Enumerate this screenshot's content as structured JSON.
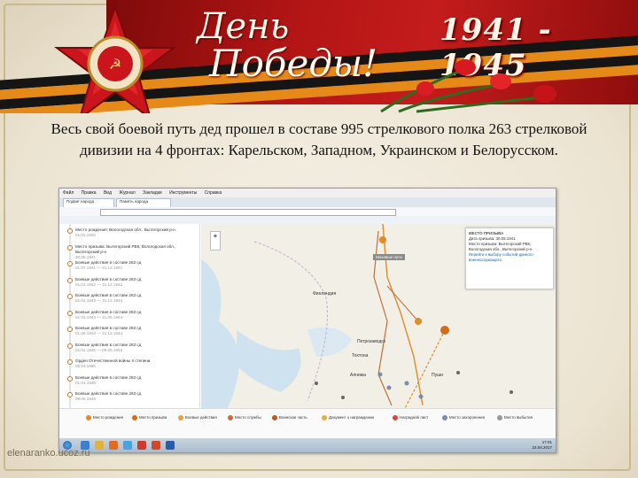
{
  "banner": {
    "title_line1": "День",
    "title_line2": "Победы!",
    "years": "1941 - 1945",
    "star_text": "ОТЕЧЕСТВЕННАЯ ВОЙНА"
  },
  "caption": "Весь свой боевой путь дед прошел в составе 995 стрелкового полка 263 стрелковой дивизии на 4 фронтах: Карельском, Западном, Украинском и Белорусском.",
  "browser": {
    "menu": [
      "Файл",
      "Правка",
      "Вид",
      "Журнал",
      "Закладки",
      "Инструменты",
      "Справка"
    ],
    "tabs": [
      "Подвиг народа",
      "Память народа"
    ],
    "map_tooltip": "Моховые пути",
    "map_labels": [
      "Финляндия",
      "Петрозаводск",
      "Тохтона",
      "Пуши",
      "Алнижа"
    ],
    "popup": {
      "title": "МЕСТО ПРИЗЫВА",
      "date": "Дата призыва: 30.05.1941",
      "lines": [
        "Место призыва: Вытегорский РВК,",
        "Вологодская обл., Вытегорский р-н"
      ],
      "link": "Перейти к выбору событий данного военнослужащего"
    },
    "timeline": [
      {
        "title": "Место рождения: Вологодская обл., Вытегорский р-н",
        "date": "01.01.1920"
      },
      {
        "title": "Место призыва: Вытегорский РВК, Вологодская обл., Вытегорский р-н",
        "date": "30.05.1941"
      },
      {
        "title": "Боевые действия в составе 263 сд",
        "date": "01.07.1941 — 31.12.1941"
      },
      {
        "title": "Боевые действия в составе 263 сд",
        "date": "01.01.1942 — 31.12.1942"
      },
      {
        "title": "Боевые действия в составе 263 сд",
        "date": "01.01.1943 — 31.12.1943"
      },
      {
        "title": "Боевые действия в составе 263 сд",
        "date": "01.01.1944 — 31.05.1944"
      },
      {
        "title": "Боевые действия в составе 263 сд",
        "date": "01.06.1944 — 31.12.1944"
      },
      {
        "title": "Боевые действия в составе 263 сд",
        "date": "01.01.1945 — 09.05.1945"
      },
      {
        "title": "Орден Отечественной войны II степени",
        "date": "06.04.1985"
      },
      {
        "title": "Боевые действия в составе 263 сд",
        "date": "01.01.1945"
      },
      {
        "title": "Боевые действия в составе 263 сд",
        "date": "09.05.1945"
      }
    ],
    "legend": [
      "Место рождения",
      "Место призыва",
      "Боевые действия",
      "Место службы",
      "Воинская часть",
      "Документ о награждении",
      "Наградной лист",
      "Место захоронения",
      "Место выбытия"
    ],
    "clock_time": "17:01",
    "clock_date": "22.04.2017"
  },
  "site": "elenaranko.ucoz.ru",
  "colors": {
    "banner_red": "#b31515",
    "ribbon_orange": "#e58a18",
    "route_orange": "#e08b2b",
    "route_brown": "#c0703a"
  }
}
